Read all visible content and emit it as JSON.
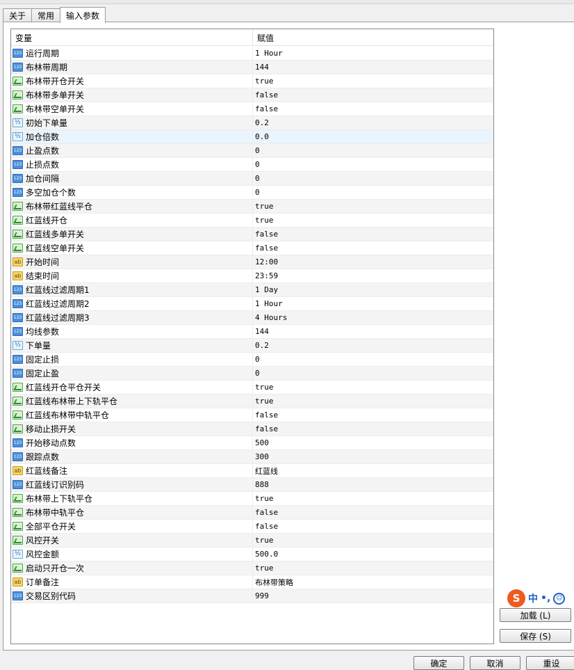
{
  "tabs": [
    "关于",
    "常用",
    "输入参数"
  ],
  "table": {
    "headers": {
      "name": "变量",
      "value": "赋值"
    },
    "rows": [
      {
        "icon": "int-icon",
        "name": "运行周期",
        "value": "1 Hour"
      },
      {
        "icon": "int-icon",
        "name": "布林带周期",
        "value": "144"
      },
      {
        "icon": "bool-icon",
        "name": "布林带开仓开关",
        "value": "true"
      },
      {
        "icon": "bool-icon",
        "name": "布林带多单开关",
        "value": "false"
      },
      {
        "icon": "bool-icon",
        "name": "布林带空单开关",
        "value": "false"
      },
      {
        "icon": "double-icon",
        "name": "初始下单量",
        "value": "0.2"
      },
      {
        "icon": "double-icon",
        "name": "加仓倍数",
        "value": "0.0"
      },
      {
        "icon": "int-icon",
        "name": "止盈点数",
        "value": "0"
      },
      {
        "icon": "int-icon",
        "name": "止损点数",
        "value": "0"
      },
      {
        "icon": "int-icon",
        "name": "加仓间隔",
        "value": "0"
      },
      {
        "icon": "int-icon",
        "name": "多空加仓个数",
        "value": "0"
      },
      {
        "icon": "bool-icon",
        "name": "布林带红蓝线平仓",
        "value": "true"
      },
      {
        "icon": "bool-icon",
        "name": "红蓝线开仓",
        "value": "true"
      },
      {
        "icon": "bool-icon",
        "name": "红蓝线多单开关",
        "value": "false"
      },
      {
        "icon": "bool-icon",
        "name": "红蓝线空单开关",
        "value": "false"
      },
      {
        "icon": "string-icon",
        "name": "开始时间",
        "value": "12:00"
      },
      {
        "icon": "string-icon",
        "name": "结束时间",
        "value": "23:59"
      },
      {
        "icon": "int-icon",
        "name": "红蓝线过滤周期1",
        "value": "1 Day"
      },
      {
        "icon": "int-icon",
        "name": "红蓝线过滤周期2",
        "value": "1 Hour"
      },
      {
        "icon": "int-icon",
        "name": "红蓝线过滤周期3",
        "value": "4 Hours"
      },
      {
        "icon": "int-icon",
        "name": "均线参数",
        "value": "144"
      },
      {
        "icon": "double-icon",
        "name": "下单量",
        "value": "0.2"
      },
      {
        "icon": "int-icon",
        "name": "固定止损",
        "value": "0"
      },
      {
        "icon": "int-icon",
        "name": "固定止盈",
        "value": "0"
      },
      {
        "icon": "bool-icon",
        "name": "红蓝线开仓平仓开关",
        "value": "true"
      },
      {
        "icon": "bool-icon",
        "name": "红蓝线布林带上下轨平仓",
        "value": "true"
      },
      {
        "icon": "bool-icon",
        "name": "红蓝线布林带中轨平仓",
        "value": "false"
      },
      {
        "icon": "bool-icon",
        "name": "移动止损开关",
        "value": "false"
      },
      {
        "icon": "int-icon",
        "name": "开始移动点数",
        "value": "500"
      },
      {
        "icon": "int-icon",
        "name": "跟踪点数",
        "value": "300"
      },
      {
        "icon": "string-icon",
        "name": "红蓝线备注",
        "value": "红蓝线"
      },
      {
        "icon": "int-icon",
        "name": "红蓝线订识别码",
        "value": "888"
      },
      {
        "icon": "bool-icon",
        "name": "布林带上下轨平仓",
        "value": "true"
      },
      {
        "icon": "bool-icon",
        "name": "布林带中轨平仓",
        "value": "false"
      },
      {
        "icon": "bool-icon",
        "name": "全部平仓开关",
        "value": "false"
      },
      {
        "icon": "bool-icon",
        "name": "风控开关",
        "value": "true"
      },
      {
        "icon": "double-icon",
        "name": "风控金额",
        "value": "500.0"
      },
      {
        "icon": "bool-icon",
        "name": "启动只开仓一次",
        "value": "true"
      },
      {
        "icon": "string-icon",
        "name": "订单备注",
        "value": "布林带策略"
      },
      {
        "icon": "int-icon",
        "name": "交易区别代码",
        "value": "999"
      }
    ]
  },
  "side_buttons": {
    "load": "加载 (L)",
    "save": "保存 (S)"
  },
  "bottom_buttons": {
    "ok": "确定",
    "cancel": "取消",
    "reset": "重设"
  },
  "ime": {
    "logo": "S",
    "mode": "中",
    "punct": "•,",
    "face": "☺"
  }
}
